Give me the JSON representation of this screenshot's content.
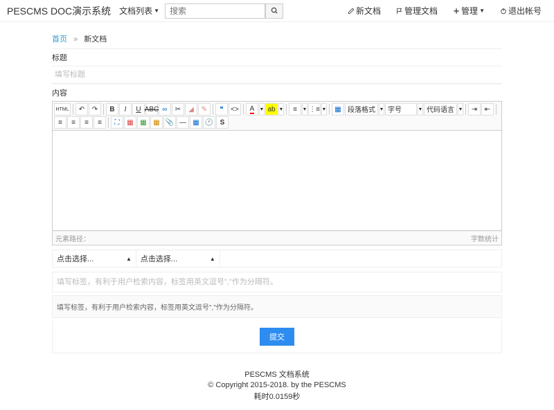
{
  "nav": {
    "brand": "PESCMS DOC演示系统",
    "docList": "文档列表",
    "searchPlaceholder": "搜索",
    "newDoc": "新文档",
    "manageDoc": "管理文档",
    "manage": "管理",
    "logout": "退出帐号"
  },
  "breadcrumb": {
    "home": "首页",
    "current": "新文档"
  },
  "form": {
    "titleLabel": "标题",
    "titlePlaceholder": "填写标题",
    "contentLabel": "内容",
    "elementPath": "元素路径：",
    "wordCount": "字数统计",
    "selectPlaceholder": "点击选择...",
    "tagsPlaceholder": "填写标签，有利于用户检索内容，标签用英文逗号\",\"作为分隔符。",
    "tagsHint": "填写标签，有利于用户检索内容，标签用英文逗号\",\"作为分隔符。",
    "submit": "提交"
  },
  "editor": {
    "paraFormat": "段落格式",
    "fontSize": "字号",
    "codeLanguage": "代码语言"
  },
  "footer": {
    "line1": "PESCMS 文档系统",
    "line2": "© Copyright 2015-2018. by the PESCMS",
    "line3": "耗时0.0159秒"
  }
}
